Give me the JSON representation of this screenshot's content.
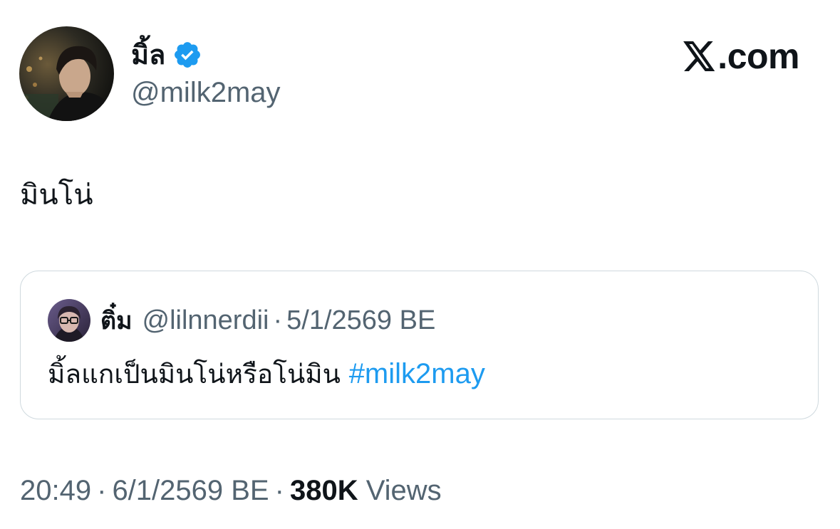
{
  "author": {
    "display_name": "มิ้ล",
    "handle": "@milk2may",
    "verified": true,
    "avatar_icon": "profile-photo-icon"
  },
  "brand": {
    "logo_text": ".com",
    "logo_icon": "x-logo-icon"
  },
  "tweet": {
    "text": "มินโน่"
  },
  "quote": {
    "display_name": "ติ๋ม",
    "handle": "@lilnnerdii",
    "separator": "·",
    "date": "5/1/2569 BE",
    "text": "มิ้ลแกเป็นมินโน่หรือโน่มิน ",
    "hashtag": "#milk2may",
    "avatar_icon": "profile-photo-icon"
  },
  "meta": {
    "time": "20:49",
    "separator": "·",
    "date": "6/1/2569 BE",
    "views_count": "380K",
    "views_label": "Views"
  },
  "colors": {
    "text_primary": "#0f1419",
    "text_secondary": "#536471",
    "link": "#1d9bf0",
    "verified": "#1d9bf0",
    "border": "#cfd9de"
  }
}
